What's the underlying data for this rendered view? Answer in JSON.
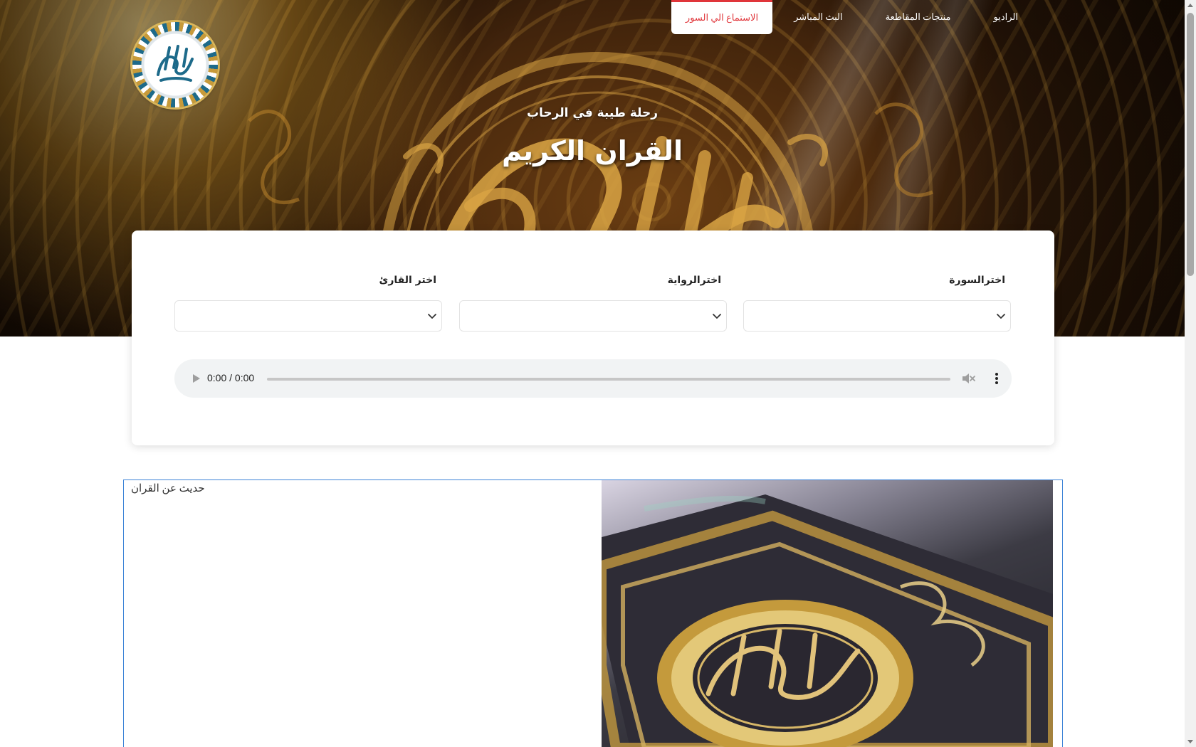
{
  "nav": {
    "items": [
      {
        "label": "الراديو",
        "active": false
      },
      {
        "label": "منتجات المقاطعة",
        "active": false
      },
      {
        "label": "البث المباشر",
        "active": false
      },
      {
        "label": "الاستماع الي السور",
        "active": true
      }
    ]
  },
  "logo": {
    "icon": "quran-calligraphy-medallion"
  },
  "hero": {
    "subtitle": "رحلة طيبة في الرحاب",
    "title": "القران الكريم"
  },
  "player": {
    "fields": [
      {
        "label": "اختر القارئ",
        "value": ""
      },
      {
        "label": "اخترالرواية",
        "value": ""
      },
      {
        "label": "اخترالسورة",
        "value": ""
      }
    ],
    "audio": {
      "time": "0:00 / 0:00",
      "progress": 0
    }
  },
  "about": {
    "text": "حديث عن القران"
  },
  "colors": {
    "accent": "#e0353a",
    "focus_border": "#3b82d6",
    "audio_bg": "#f1f3f4"
  }
}
